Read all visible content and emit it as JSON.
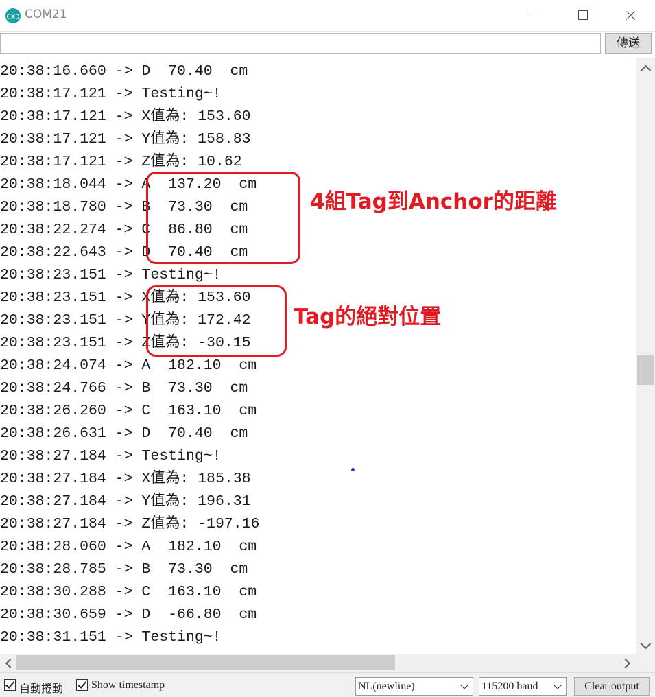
{
  "window": {
    "title": "COM21",
    "app_icon": "arduino-logo-icon",
    "controls": [
      "minimize-icon",
      "maximize-icon",
      "close-icon"
    ]
  },
  "input_bar": {
    "value": "",
    "send_label": "傳送"
  },
  "output_lines": [
    "20:38:16.660 -> D  70.40  cm",
    "20:38:17.121 -> Testing~!",
    "20:38:17.121 -> X值為: 153.60",
    "20:38:17.121 -> Y值為: 158.83",
    "20:38:17.121 -> Z值為: 10.62",
    "20:38:18.044 -> A  137.20  cm",
    "20:38:18.780 -> B  73.30  cm",
    "20:38:22.274 -> C  86.80  cm",
    "20:38:22.643 -> D  70.40  cm",
    "20:38:23.151 -> Testing~!",
    "20:38:23.151 -> X值為: 153.60",
    "20:38:23.151 -> Y值為: 172.42",
    "20:38:23.151 -> Z值為: -30.15",
    "20:38:24.074 -> A  182.10  cm",
    "20:38:24.766 -> B  73.30  cm",
    "20:38:26.260 -> C  163.10  cm",
    "20:38:26.631 -> D  70.40  cm",
    "20:38:27.184 -> Testing~!",
    "20:38:27.184 -> X值為: 185.38",
    "20:38:27.184 -> Y值為: 196.31",
    "20:38:27.184 -> Z值為: -197.16",
    "20:38:28.060 -> A  182.10  cm",
    "20:38:28.785 -> B  73.30  cm",
    "20:38:30.288 -> C  163.10  cm",
    "20:38:30.659 -> D  -66.80  cm",
    "20:38:31.151 -> Testing~!"
  ],
  "annotations": {
    "distances_label": "4組Tag到Anchor的距離",
    "position_label": "Tag的絕對位置",
    "color": "#e01b23"
  },
  "footer": {
    "autoscroll": {
      "label": "自動捲動",
      "checked": true
    },
    "timestamp": {
      "label": "Show timestamp",
      "checked": true
    },
    "line_ending": "NL(newline)",
    "baud": "115200 baud",
    "clear_label": "Clear output"
  }
}
